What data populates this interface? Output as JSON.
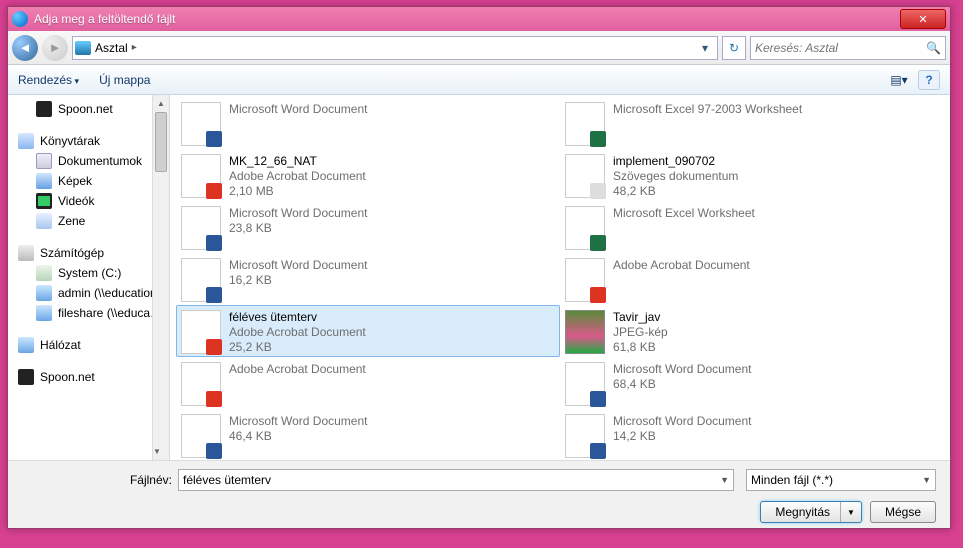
{
  "window": {
    "title": "Adja meg a feltöltendő fájlt"
  },
  "nav": {
    "location": "Asztal",
    "search_placeholder": "Keresés: Asztal"
  },
  "toolbar": {
    "organize": "Rendezés",
    "newfolder": "Új mappa"
  },
  "tree": {
    "items": [
      {
        "label": "Spoon.net",
        "icon": "ico-spoon",
        "indent": true
      },
      {
        "spacer": true
      },
      {
        "label": "Könyvtárak",
        "icon": "ico-lib"
      },
      {
        "label": "Dokumentumok",
        "icon": "ico-doc",
        "indent": true
      },
      {
        "label": "Képek",
        "icon": "ico-pic",
        "indent": true
      },
      {
        "label": "Videók",
        "icon": "ico-vid",
        "indent": true
      },
      {
        "label": "Zene",
        "icon": "ico-music",
        "indent": true
      },
      {
        "spacer": true
      },
      {
        "label": "Számítógép",
        "icon": "ico-pc"
      },
      {
        "label": "System (C:)",
        "icon": "ico-drive",
        "indent": true
      },
      {
        "label": "admin (\\\\education…",
        "icon": "ico-net",
        "indent": true
      },
      {
        "label": "fileshare (\\\\educa…",
        "icon": "ico-net",
        "indent": true
      },
      {
        "spacer": true
      },
      {
        "label": "Hálózat",
        "icon": "ico-net"
      },
      {
        "spacer": true
      },
      {
        "label": "Spoon.net",
        "icon": "ico-spoon"
      }
    ]
  },
  "files": [
    {
      "name": "",
      "type": "Microsoft Word Document",
      "size": "",
      "badge": "word"
    },
    {
      "name": "",
      "type": "Microsoft Excel 97-2003 Worksheet",
      "size": "",
      "badge": "excel"
    },
    {
      "name": "MK_12_66_NAT",
      "type": "Adobe Acrobat Document",
      "size": "2,10 MB",
      "badge": "pdf"
    },
    {
      "name": "implement_090702",
      "type": "Szöveges dokumentum",
      "size": "48,2 KB",
      "badge": "txt"
    },
    {
      "name": "",
      "type": "Microsoft Word Document",
      "size": "23,8 KB",
      "badge": "word"
    },
    {
      "name": "",
      "type": "Microsoft Excel Worksheet",
      "size": "",
      "badge": "excel"
    },
    {
      "name": "",
      "type": "Microsoft Word Document",
      "size": "16,2 KB",
      "badge": "word"
    },
    {
      "name": "",
      "type": "Adobe Acrobat Document",
      "size": "",
      "badge": "pdf"
    },
    {
      "name": "féléves ütemterv",
      "type": "Adobe Acrobat Document",
      "size": "25,2 KB",
      "badge": "pdf",
      "selected": true
    },
    {
      "name": "Tavir_jav",
      "type": "JPEG-kép",
      "size": "61,8 KB",
      "image": true
    },
    {
      "name": "",
      "type": "Adobe Acrobat Document",
      "size": "",
      "badge": "pdf"
    },
    {
      "name": "",
      "type": "Microsoft Word Document",
      "size": "68,4 KB",
      "badge": "word"
    },
    {
      "name": "",
      "type": "Microsoft Word Document",
      "size": "46,4 KB",
      "badge": "word"
    },
    {
      "name": "",
      "type": "Microsoft Word Document",
      "size": "14,2 KB",
      "badge": "word"
    }
  ],
  "footer": {
    "filename_label": "Fájlnév:",
    "filename_value": "féléves ütemterv",
    "filter": "Minden fájl (*.*)",
    "open": "Megnyitás",
    "cancel": "Mégse"
  }
}
